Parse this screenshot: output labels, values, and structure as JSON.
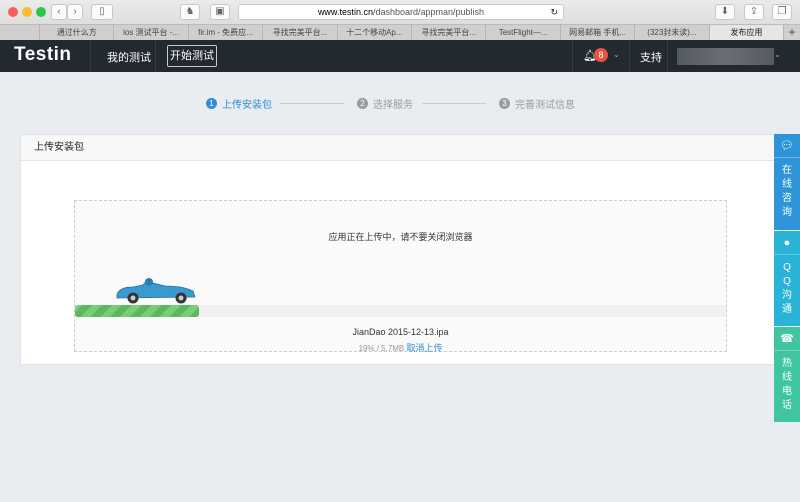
{
  "browser": {
    "url_host": "www.testin.cn",
    "url_path": "/dashboard/appman/publish",
    "tabs": [
      "通过什么方",
      "ios 测试平台 -...",
      "fir.im - 免费应...",
      "寻找完美平台...",
      "十二个移动Ap...",
      "寻找完美平台...",
      "TestFlight—...",
      "网易邮箱 手机...",
      "(323封未读)...",
      "发布应用"
    ],
    "new_tab": "+"
  },
  "nav": {
    "logo": "Testin",
    "my_tests": "我的测试",
    "start_test": "开始测试",
    "notifications": "8",
    "support": "支持"
  },
  "steps": [
    {
      "n": "1",
      "label": "上传安装包"
    },
    {
      "n": "2",
      "label": "选择服务"
    },
    {
      "n": "3",
      "label": "完善测试信息"
    }
  ],
  "panel": {
    "title": "上传安装包",
    "message": "应用正在上传中，请不要关闭浏览器",
    "file_name": "JianDao 2015-12-13.ipa",
    "progress_text": "19% / 5.7MB",
    "cancel": "取消上传",
    "progress_percent": 19
  },
  "side": {
    "online": "在线咨询",
    "qq": "QQ沟通",
    "hotline": "热线电话",
    "colors": [
      "#2e95d8",
      "#29b3d6",
      "#3fc6a0"
    ]
  }
}
